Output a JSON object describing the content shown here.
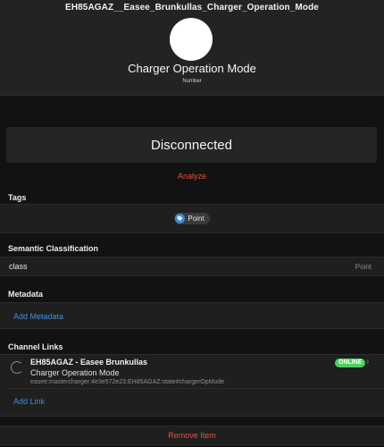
{
  "header": {
    "item_name": "EH85AGAZ__Easee_Brunkullas_Charger_Operation_Mode",
    "label": "Charger Operation Mode",
    "type": "Number"
  },
  "state": {
    "value": "Disconnected",
    "analyze_label": "Analyze"
  },
  "tags": {
    "title": "Tags",
    "items": [
      {
        "label": "Point",
        "icon": "tag-icon",
        "icon_color": "#3b8bd9"
      }
    ]
  },
  "semantic": {
    "title": "Semantic Classification",
    "label": "class",
    "value": "Point"
  },
  "metadata": {
    "title": "Metadata",
    "add_label": "Add Metadata"
  },
  "channel_links": {
    "title": "Channel Links",
    "links": [
      {
        "thing_title": "EH85AGAZ - Easee Brunkullas",
        "channel_label": "Charger Operation Mode",
        "channel_uid": "easee:mastercharger:4e3e572e23:EH85AGAZ:state#chargerOpMode",
        "status": "ONLINE",
        "status_color": "#4cd05c"
      }
    ],
    "add_label": "Add Link"
  },
  "actions": {
    "remove_label": "Remove Item"
  },
  "colors": {
    "background": "#121212",
    "accent_red": "#e0533d",
    "accent_blue": "#3d8fe0"
  }
}
